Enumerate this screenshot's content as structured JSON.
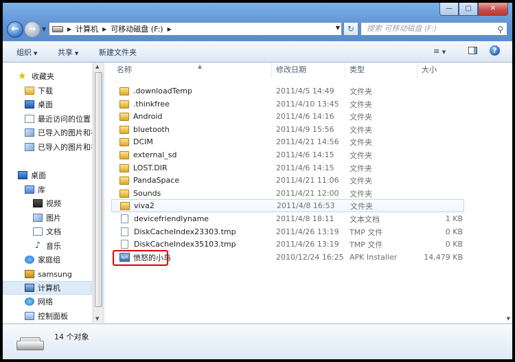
{
  "window": {
    "caption_buttons": {
      "minimize": "—",
      "maximize": "□",
      "close": "✕"
    }
  },
  "address": {
    "crumbs": [
      "计算机",
      "可移动磁盘 (F:)"
    ],
    "search_placeholder": "搜索 可移动磁盘 (F:)"
  },
  "toolbar": {
    "organize": "组织",
    "share": "共享",
    "new_folder": "新建文件夹"
  },
  "nav": {
    "favorites": "收藏夹",
    "downloads": "下载",
    "desktop_fav": "桌面",
    "recent": "最近访问的位置",
    "imported1": "已导入的图片和视",
    "imported2": "已导入的图片和视",
    "desktop": "桌面",
    "libraries": "库",
    "videos": "视频",
    "pictures": "图片",
    "documents": "文档",
    "music": "音乐",
    "homegroup": "家庭组",
    "user": "samsung",
    "computer": "计算机",
    "network": "网络",
    "control_panel": "控制面板"
  },
  "columns": {
    "name": "名称",
    "date": "修改日期",
    "type": "类型",
    "size": "大小"
  },
  "files": [
    {
      "name": ".downloadTemp",
      "date": "2011/4/5 14:49",
      "type": "文件夹",
      "size": "",
      "kind": "folder"
    },
    {
      "name": ".thinkfree",
      "date": "2011/4/10 13:45",
      "type": "文件夹",
      "size": "",
      "kind": "folder"
    },
    {
      "name": "Android",
      "date": "2011/4/6 14:16",
      "type": "文件夹",
      "size": "",
      "kind": "folder"
    },
    {
      "name": "bluetooth",
      "date": "2011/4/9 15:56",
      "type": "文件夹",
      "size": "",
      "kind": "folder"
    },
    {
      "name": "DCIM",
      "date": "2011/4/21 14:56",
      "type": "文件夹",
      "size": "",
      "kind": "folder"
    },
    {
      "name": "external_sd",
      "date": "2011/4/6 14:15",
      "type": "文件夹",
      "size": "",
      "kind": "folder"
    },
    {
      "name": "LOST.DIR",
      "date": "2011/4/6 14:15",
      "type": "文件夹",
      "size": "",
      "kind": "folder"
    },
    {
      "name": "PandaSpace",
      "date": "2011/4/21 11:06",
      "type": "文件夹",
      "size": "",
      "kind": "folder"
    },
    {
      "name": "Sounds",
      "date": "2011/4/21 12:00",
      "type": "文件夹",
      "size": "",
      "kind": "folder"
    },
    {
      "name": "viva2",
      "date": "2011/4/8 16:53",
      "type": "文件夹",
      "size": "",
      "kind": "folder"
    },
    {
      "name": "devicefriendlyname",
      "date": "2011/4/8 18:11",
      "type": "文本文档",
      "size": "1 KB",
      "kind": "file"
    },
    {
      "name": "DiskCacheIndex23303.tmp",
      "date": "2011/4/26 13:19",
      "type": "TMP 文件",
      "size": "0 KB",
      "kind": "file"
    },
    {
      "name": "DiskCacheIndex35103.tmp",
      "date": "2011/4/26 13:19",
      "type": "TMP 文件",
      "size": "0 KB",
      "kind": "file"
    },
    {
      "name": "愤怒的小鸟",
      "date": "2010/12/24 16:25",
      "type": "APK Installer",
      "size": "14,479 KB",
      "kind": "apk"
    }
  ],
  "status": {
    "object_count": "14 个对象"
  },
  "colors": {
    "highlight_border": "#e00000",
    "chrome_blue": "#5f92d3"
  }
}
